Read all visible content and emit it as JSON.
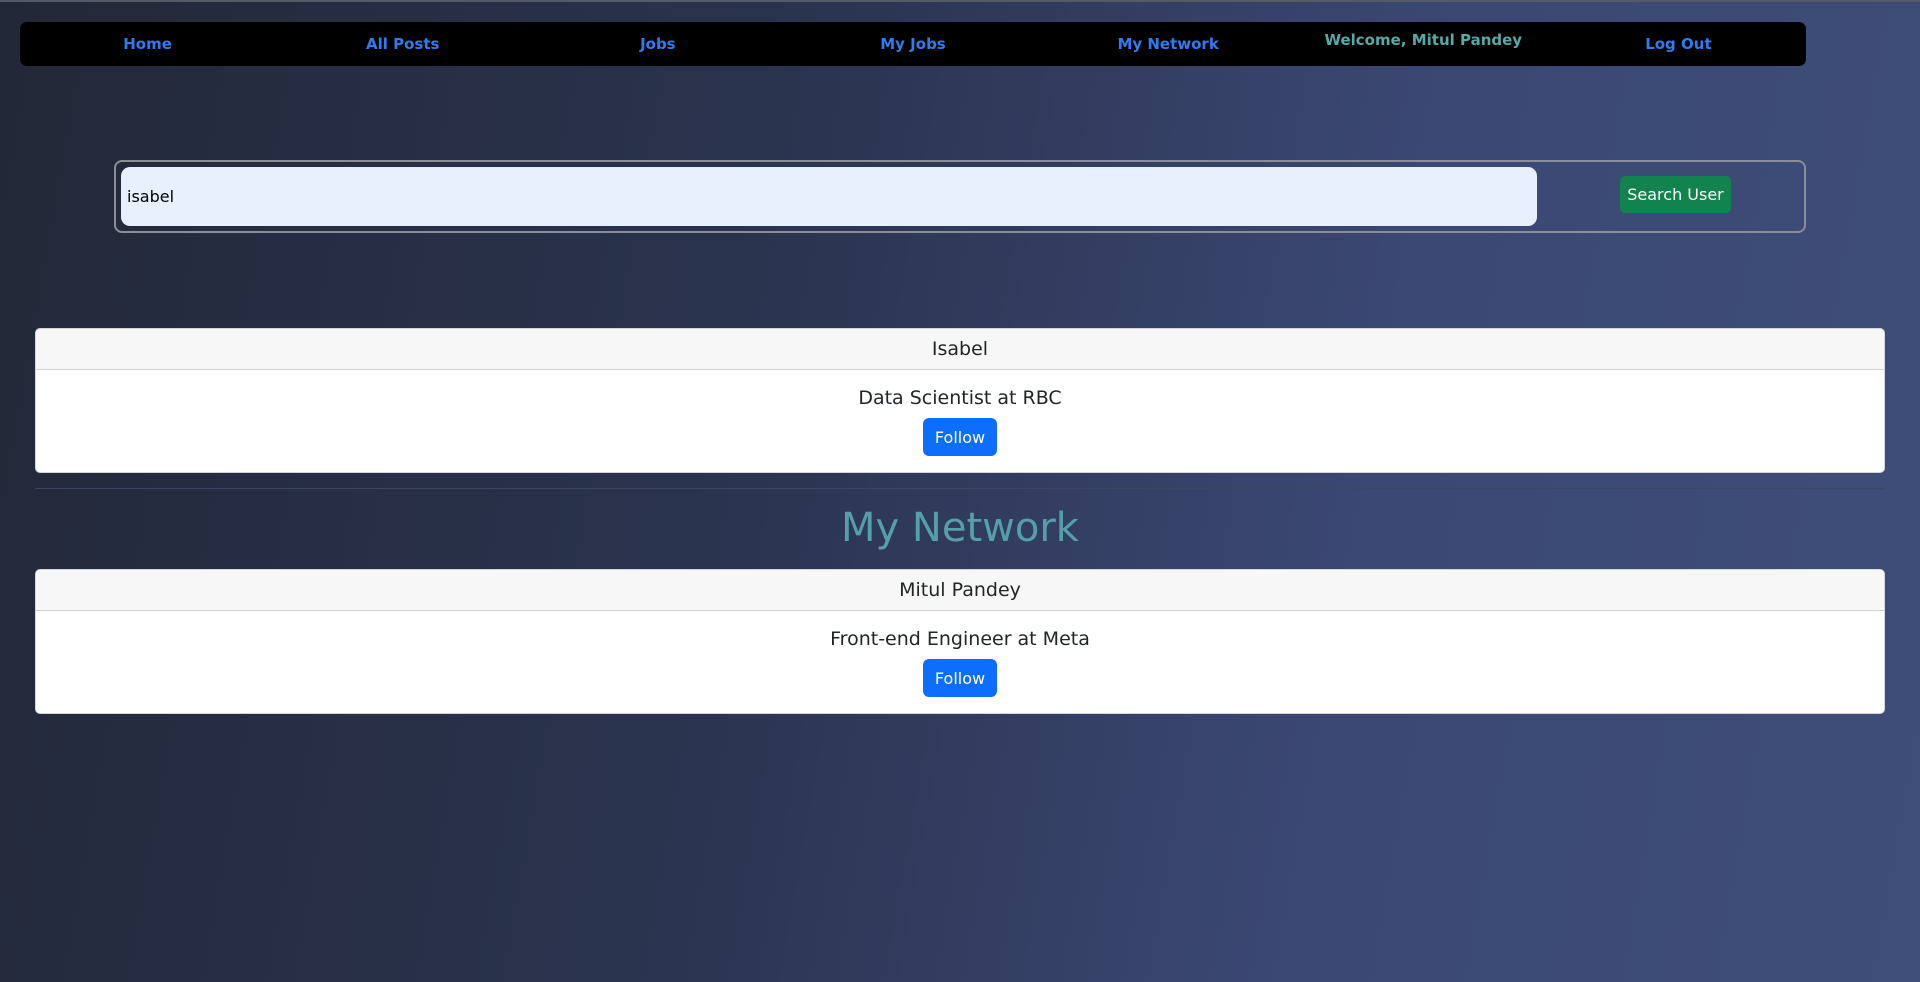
{
  "nav": {
    "home": "Home",
    "all_posts": "All Posts",
    "jobs": "Jobs",
    "my_jobs": "My Jobs",
    "my_network": "My Network",
    "welcome": "Welcome, Mitul Pandey",
    "log_out": "Log Out"
  },
  "search": {
    "value": "isabel",
    "button_label": "Search User"
  },
  "search_results": [
    {
      "name": "Isabel",
      "headline": "Data Scientist at RBC",
      "button": "Follow"
    }
  ],
  "network": {
    "title": "My Network",
    "items": [
      {
        "name": "Mitul Pandey",
        "headline": "Front-end Engineer at Meta",
        "button": "Follow"
      }
    ]
  },
  "colors": {
    "nav_link": "#2f7cf0",
    "welcome": "#59a8a8",
    "search_button": "#12834f",
    "follow_button": "#0d6efd",
    "section_title": "#55a0a8"
  }
}
